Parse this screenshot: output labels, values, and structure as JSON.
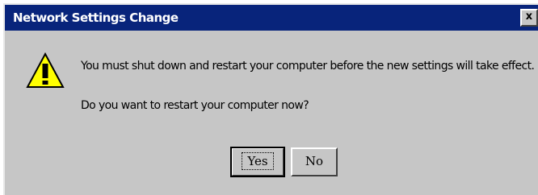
{
  "window": {
    "title": "Network Settings Change",
    "close_glyph": "x"
  },
  "message": {
    "line1": "You must shut down and restart your computer before the new settings will take effect.",
    "line2": "Do you want to restart your computer now?"
  },
  "buttons": {
    "yes_label": "Yes",
    "no_label": "No"
  },
  "icons": {
    "warning": "warning-triangle-icon"
  },
  "colors": {
    "titlebar": "#08247b",
    "face": "#c6c6c6",
    "icon_fill": "#ffff00"
  }
}
